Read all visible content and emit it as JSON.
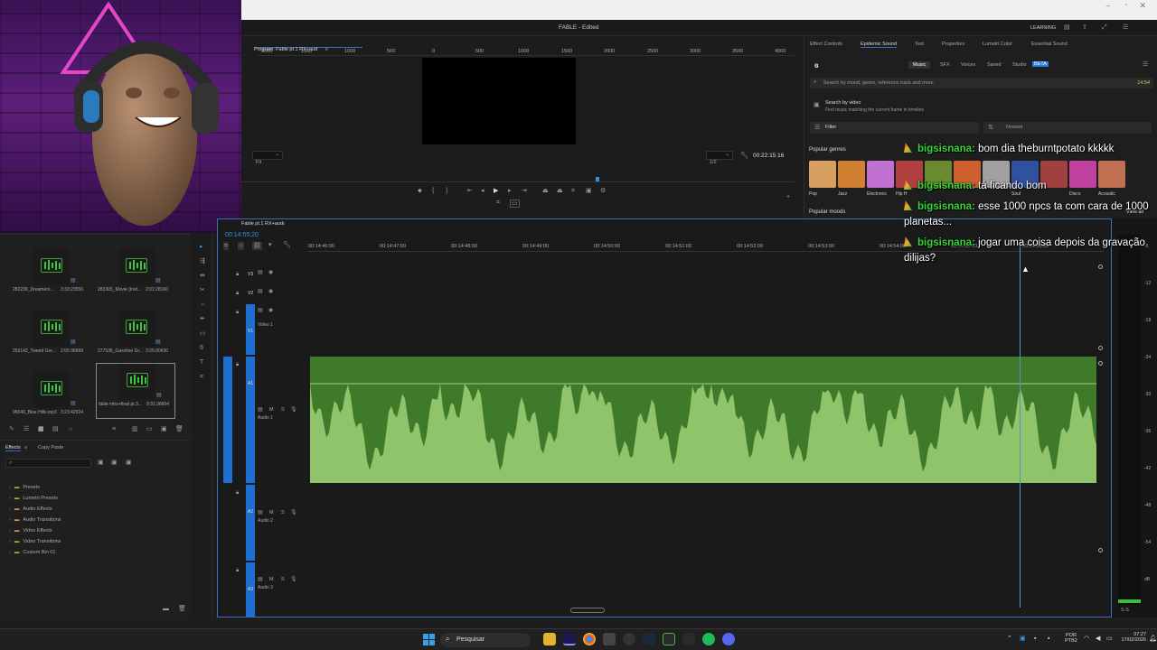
{
  "window": {
    "title": "FABLE - Edited",
    "workspace_label": "LEARNING"
  },
  "program_monitor": {
    "tab_label": "Program: Fable pt.1 RX+aud",
    "ruler_ticks": [
      "2000",
      "1500",
      "1000",
      "500",
      "0",
      "500",
      "1000",
      "1500",
      "2000",
      "2500",
      "3000",
      "3500",
      "4000"
    ],
    "fit_label": "Fit",
    "resolution_label": "1/2",
    "timecode": "00:22:15:16"
  },
  "right_panel": {
    "tabs": [
      "Effect Controls",
      "Epidemic Sound",
      "Text",
      "Properties",
      "Lumetri Color",
      "Essential Sound"
    ],
    "subtabs": [
      "Music",
      "SFX",
      "Voices",
      "Saved",
      "Studio"
    ],
    "beta_badge": "BETA",
    "search_placeholder": "Search by mood, genre, reference track and more",
    "search_time": "14:54",
    "search_by_video_title": "Search by video",
    "search_by_video_desc": "Find music matching the current frame in timeline",
    "filter_label": "Filter",
    "sort_label": "Newest",
    "popular_genres_label": "Popular genres",
    "view_all_label": "View all",
    "genres": [
      "Pop",
      "Jazz",
      "Electronic",
      "Hip H",
      "",
      "",
      "",
      "Soul",
      "",
      "Disco",
      "Acoustic"
    ],
    "genre_colors": [
      "#d8a060",
      "#d08030",
      "#c070d0",
      "#b04040",
      "#6a8a30",
      "#d06030",
      "#a0a0a0",
      "#3050a0",
      "#a04040",
      "#c040a0",
      "#c07050"
    ],
    "popular_moods_label": "Popular moods"
  },
  "chat": [
    {
      "user": "bigsisnana:",
      "message": "bom dia theburntpotato kkkkk"
    },
    {
      "user": "bigsisnana:",
      "message": "tá ficando bom"
    },
    {
      "user": "bigsisnana:",
      "message": "esse 1000 npcs ta com cara de 1000 planetas..."
    },
    {
      "user": "bigsisnana:",
      "message": "jogar uma coisa depois da gravação dilijas?"
    }
  ],
  "project_bin": {
    "items": [
      {
        "name": "283239_Dreamers...",
        "duration": "3:33:23550"
      },
      {
        "name": "283365_Movie (Inst...",
        "duration": "2:01:28160"
      },
      {
        "name": "253142_Tweed Gor...",
        "duration": "2:55:36899"
      },
      {
        "name": "277536_Gasoline Gr...",
        "duration": "3:25:00600"
      },
      {
        "name": "96049_Blue Hills.mp3",
        "duration": "3:23:42924"
      },
      {
        "name": "fable intro+final pt.3...",
        "duration": "9:31:36854"
      }
    ]
  },
  "effects_panel": {
    "tabs": [
      "Effects",
      "Copy Paste"
    ],
    "items": [
      "Presets",
      "Lumetri Presets",
      "Audio Effects",
      "Audio Transitions",
      "Video Effects",
      "Video Transitions",
      "Custom Bin 01"
    ]
  },
  "timeline": {
    "tab_label": "Fable pt.1 RX+aud",
    "timecode": "00:14:55:20",
    "ruler": [
      "00:14:46:00",
      "00:14:47:00",
      "00:14:48:00",
      "00:14:49:00",
      "00:14:50:00",
      "00:14:51:00",
      "00:14:52:00",
      "00:14:53:00",
      "00:14:54:00",
      "00:14:55:00",
      "00:14:56:00"
    ],
    "tracks": [
      {
        "id": "V3",
        "name": ""
      },
      {
        "id": "V2",
        "name": ""
      },
      {
        "id": "V1",
        "name": "Video 1"
      },
      {
        "id": "A1",
        "name": "Audio 1"
      },
      {
        "id": "A2",
        "name": "Audio 2"
      },
      {
        "id": "A3",
        "name": "Audio 3"
      }
    ],
    "waveform_color": "#8fc46a"
  },
  "meters": {
    "scale": [
      "-6",
      "-12",
      "-18",
      "-24",
      "-30",
      "-36",
      "-42",
      "-48",
      "-54",
      "dB"
    ],
    "footer": "S    S"
  },
  "taskbar": {
    "search_label": "Pesquisar",
    "lang_top": "POR",
    "lang_bottom": "PTB2",
    "time": "07:27",
    "date": "17/02/2026"
  }
}
